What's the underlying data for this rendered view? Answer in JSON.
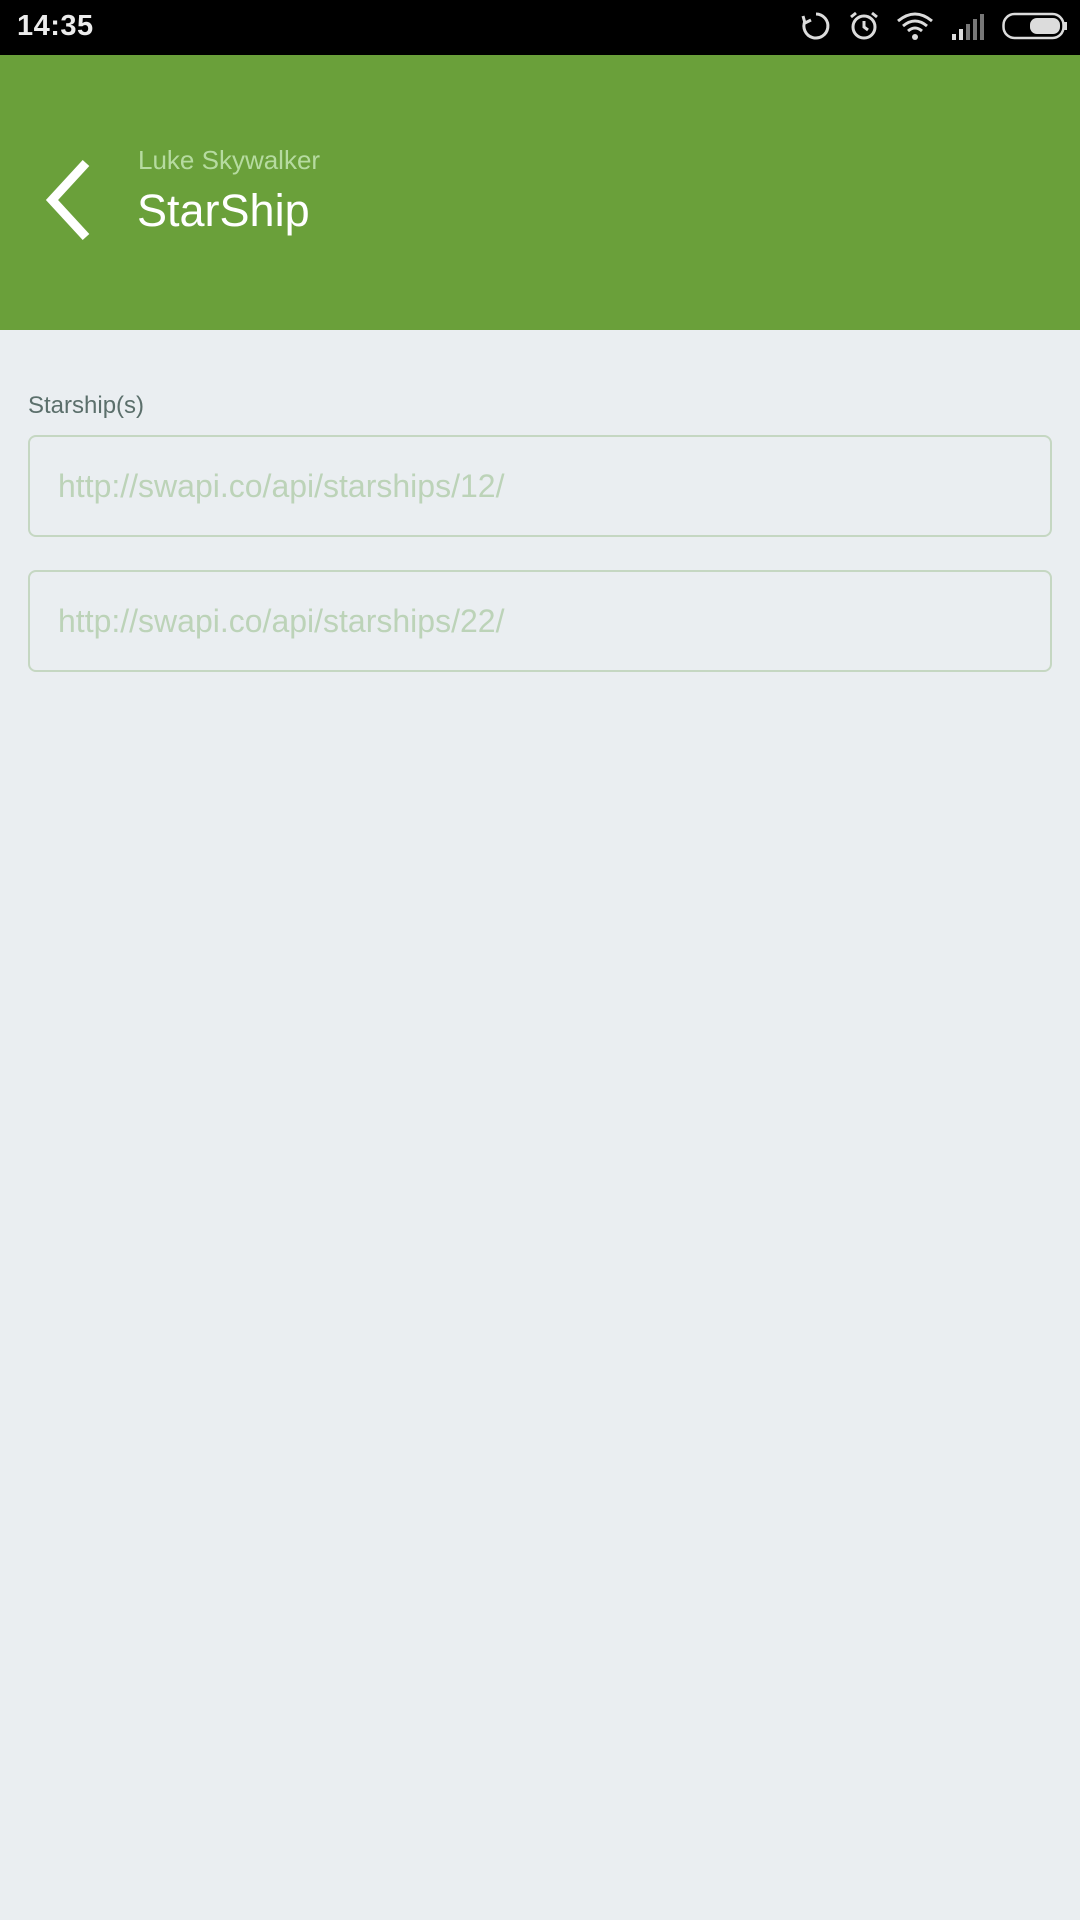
{
  "status_bar": {
    "time": "14:35",
    "icons": [
      "sync-icon",
      "alarm-icon",
      "wifi-icon",
      "signal-icon",
      "battery-icon"
    ]
  },
  "app_bar": {
    "subtitle": "Luke Skywalker",
    "title": "StarShip",
    "color": "#6aa03a"
  },
  "main": {
    "section_label": "Starship(s)",
    "starships": [
      "http://swapi.co/api/starships/12/",
      "http://swapi.co/api/starships/22/"
    ]
  }
}
